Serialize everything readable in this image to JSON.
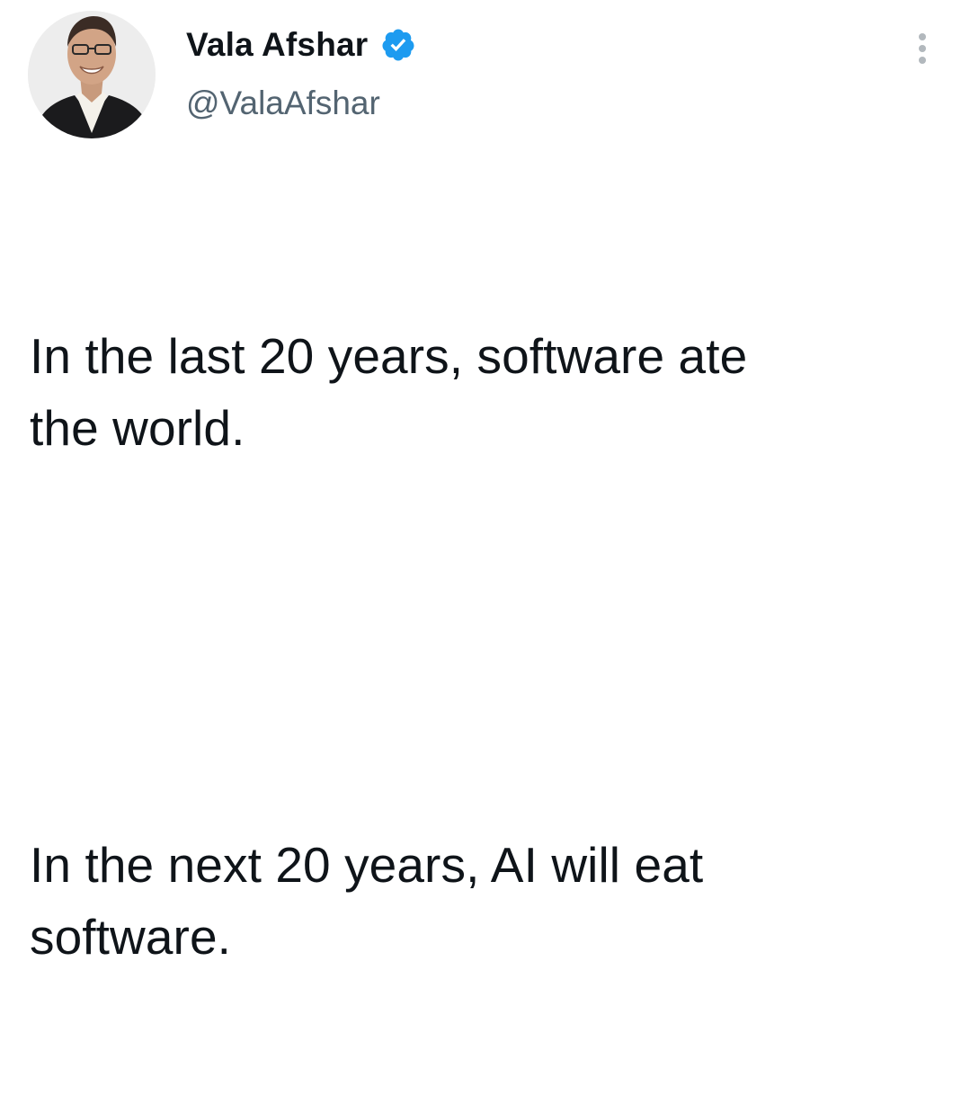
{
  "author": {
    "display_name": "Vala Afshar",
    "handle": "@ValaAfshar",
    "verified": true,
    "avatar_icon": "profile-photo"
  },
  "tweet": {
    "paragraphs": [
      "In the last 20 years, software ate\nthe world.",
      "In the next 20 years, AI will eat\nsoftware."
    ]
  },
  "icons": {
    "verified_badge": "verified-badge-icon",
    "more": "more-options-icon"
  },
  "colors": {
    "text_primary": "#0f1419",
    "text_secondary": "#536471",
    "verified_blue": "#1d9bf0",
    "background": "#ffffff"
  }
}
